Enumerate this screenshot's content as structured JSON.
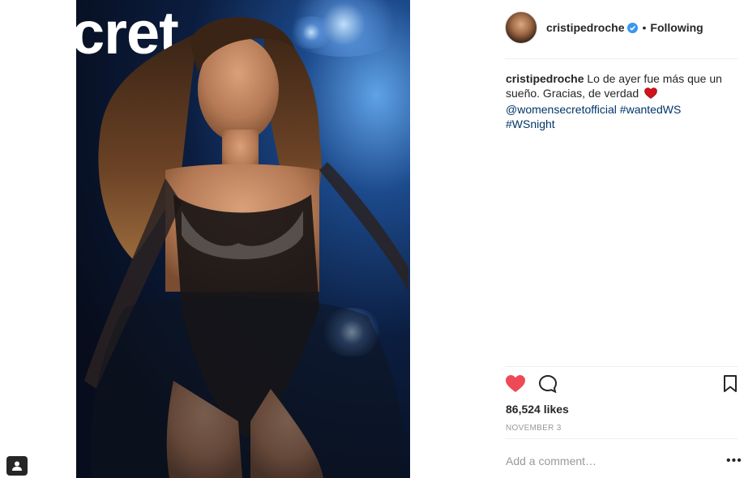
{
  "post": {
    "brand_overlay_text": "cret",
    "image_alt": "Woman in black lace bodysuit on a runway"
  },
  "header": {
    "username": "cristipedroche",
    "separator": "•",
    "follow_status": "Following"
  },
  "caption": {
    "username": "cristipedroche",
    "text": "Lo de ayer fue más que un sueño. Gracias, de verdad",
    "mention": "@womensecretofficial",
    "hashtag1": "#wantedWS",
    "hashtag2": "#WSnight"
  },
  "stats": {
    "likes": "86,524 likes",
    "date": "NOVEMBER 3"
  },
  "comment": {
    "placeholder": "Add a comment…",
    "more": "•••"
  },
  "icons": {
    "like": "heart-icon",
    "comment": "comment-icon",
    "save": "bookmark-icon",
    "tag": "user-tag-icon",
    "verified": "verified-badge-icon"
  },
  "colors": {
    "like_active": "#ed4956",
    "link": "#003569",
    "verified": "#3897f0",
    "muted": "#999999"
  }
}
